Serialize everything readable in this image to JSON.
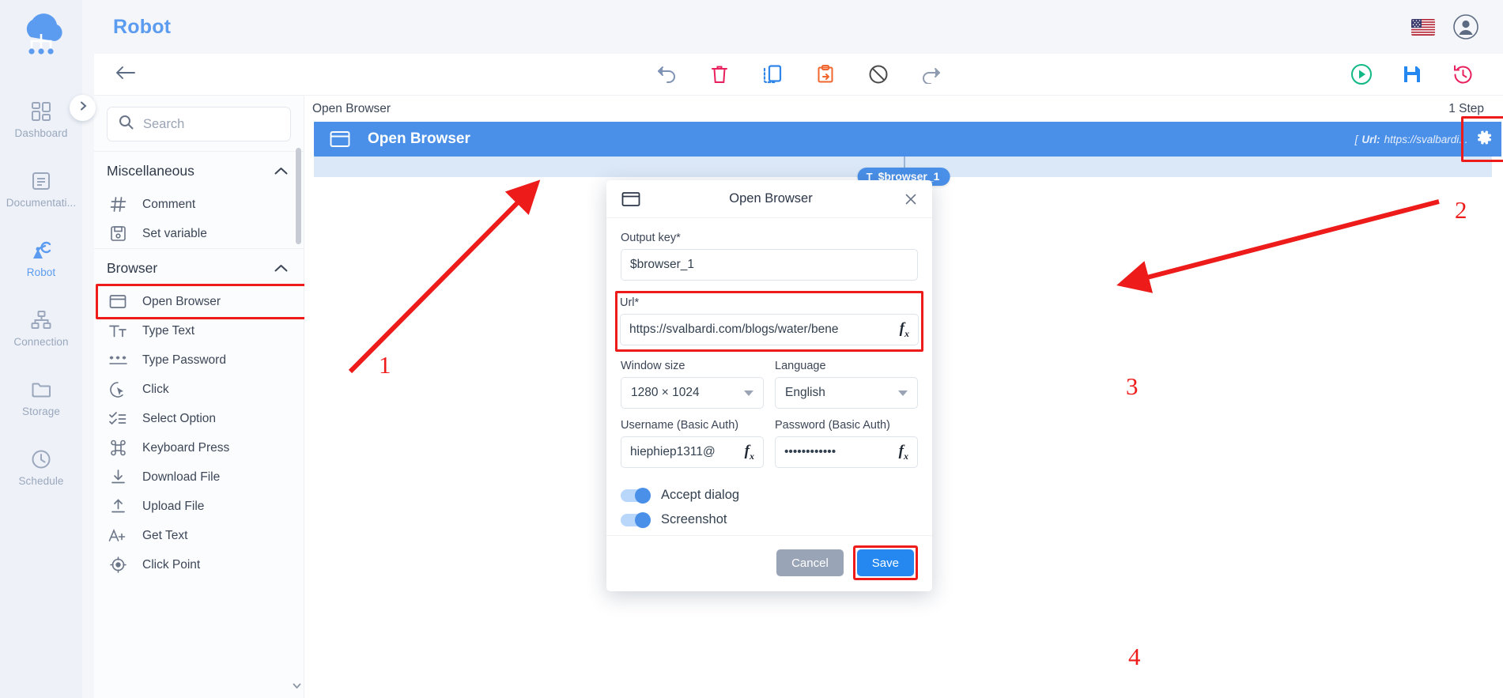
{
  "app": {
    "page_title": "Robot",
    "logo_icon": "cloud-robot-logo",
    "flag_icon": "us-flag-icon",
    "avatar_icon": "user-avatar-icon",
    "rail_toggle_icon": "chevron-right-icon"
  },
  "sidebar": {
    "items": [
      {
        "label": "Dashboard",
        "icon": "dashboard-icon",
        "active": false
      },
      {
        "label": "Documentati...",
        "icon": "document-icon",
        "active": false
      },
      {
        "label": "Robot",
        "icon": "robot-arm-icon",
        "active": true
      },
      {
        "label": "Connection",
        "icon": "connection-tree-icon",
        "active": false
      },
      {
        "label": "Storage",
        "icon": "folder-icon",
        "active": false
      },
      {
        "label": "Schedule",
        "icon": "clock-icon",
        "active": false
      }
    ]
  },
  "toolbar": {
    "back_icon": "arrow-left-icon",
    "center_icons": [
      {
        "name": "undo-icon",
        "color": "#7f93b5"
      },
      {
        "name": "delete-trash-icon",
        "color": "#e8205e"
      },
      {
        "name": "duplicate-icon",
        "color": "#2f85e8"
      },
      {
        "name": "paste-icon",
        "color": "#f0662e"
      },
      {
        "name": "disable-icon",
        "color": "#4a4a4a"
      },
      {
        "name": "redo-icon",
        "color": "#8f9cb0"
      }
    ],
    "right_icons": [
      {
        "name": "run-play-icon",
        "color": "#12b886"
      },
      {
        "name": "save-disk-icon",
        "color": "#2488f0"
      },
      {
        "name": "history-icon",
        "color": "#e8205e"
      }
    ]
  },
  "search": {
    "placeholder": "Search",
    "value": "",
    "icon": "search-icon"
  },
  "action_groups": [
    {
      "title": "Miscellaneous",
      "collapse_icon": "chevron-up-icon",
      "actions": [
        {
          "label": "Comment",
          "icon": "hash-icon",
          "highlight": false
        },
        {
          "label": "Set variable",
          "icon": "save-variable-icon",
          "highlight": false
        }
      ]
    },
    {
      "title": "Browser",
      "collapse_icon": "chevron-up-icon",
      "actions": [
        {
          "label": "Open Browser",
          "icon": "browser-window-icon",
          "highlight": true
        },
        {
          "label": "Type Text",
          "icon": "type-text-icon",
          "highlight": false
        },
        {
          "label": "Type Password",
          "icon": "type-password-icon",
          "highlight": false
        },
        {
          "label": "Click",
          "icon": "click-cursor-icon",
          "highlight": false
        },
        {
          "label": "Select Option",
          "icon": "select-option-icon",
          "highlight": false
        },
        {
          "label": "Keyboard Press",
          "icon": "keyboard-command-icon",
          "highlight": false
        },
        {
          "label": "Download File",
          "icon": "download-icon",
          "highlight": false
        },
        {
          "label": "Upload File",
          "icon": "upload-icon",
          "highlight": false
        },
        {
          "label": "Get Text",
          "icon": "get-text-icon",
          "highlight": false
        },
        {
          "label": "Click Point",
          "icon": "click-point-icon",
          "highlight": false
        }
      ]
    }
  ],
  "canvas": {
    "flow_name": "Open Browser",
    "step_count": "1 Step",
    "step": {
      "title": "Open Browser",
      "icon": "browser-window-icon",
      "meta_open": "[",
      "meta_key": "Url:",
      "meta_value": "https://svalbardi....",
      "meta_close": "]",
      "gear_icon": "gear-icon",
      "variable_chip": "$browser_1",
      "variable_type": "T"
    }
  },
  "modal": {
    "title": "Open Browser",
    "icon": "browser-window-icon",
    "close_icon": "close-icon",
    "fields": {
      "output_key": {
        "label": "Output key*",
        "value": "$browser_1"
      },
      "url": {
        "label": "Url*",
        "value": "https://svalbardi.com/blogs/water/bene",
        "fx": "fx"
      },
      "window_size": {
        "label": "Window size",
        "value": "1280 × 1024"
      },
      "language": {
        "label": "Language",
        "value": "English"
      },
      "username": {
        "label": "Username (Basic Auth)",
        "value": "hiephiep1311@",
        "fx": "fx"
      },
      "password": {
        "label": "Password (Basic Auth)",
        "value": "••••••••••••",
        "fx": "fx"
      }
    },
    "toggles": [
      {
        "label": "Accept dialog",
        "on": true
      },
      {
        "label": "Screenshot",
        "on": true
      }
    ],
    "buttons": {
      "cancel": "Cancel",
      "save": "Save"
    }
  },
  "annotations": {
    "numbers": [
      "1",
      "2",
      "3",
      "4"
    ]
  },
  "colors": {
    "accent": "#4a90e8",
    "brand": "#5b9bf0",
    "annotation": "#ee1b1b",
    "save": "#2488f0",
    "cancel": "#9aa4b7"
  }
}
